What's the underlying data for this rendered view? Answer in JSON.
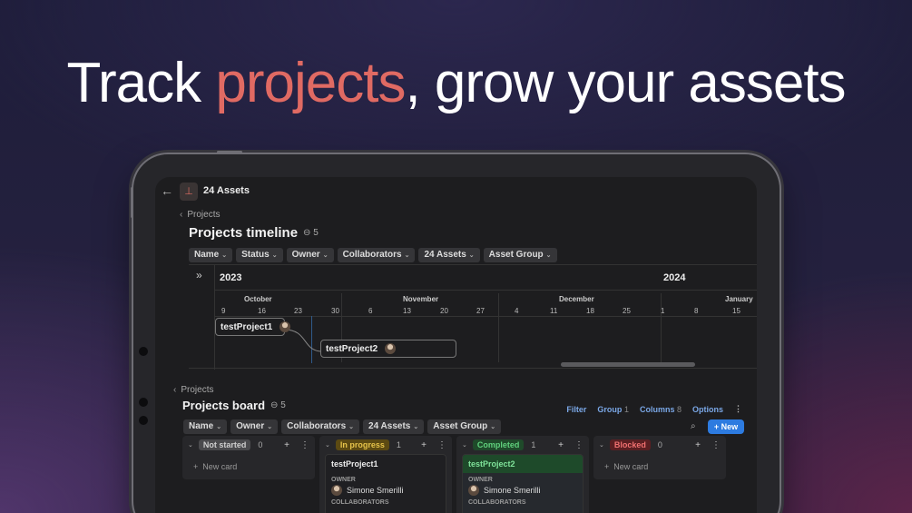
{
  "headline": {
    "before": "Track ",
    "highlight": "projects",
    "after": ", grow your assets"
  },
  "colors": {
    "highlight": "#e06a63",
    "accent_blue": "#2d7be0",
    "link_blue": "#7aa7e6"
  },
  "app": {
    "back_icon": "arrow-left-icon",
    "page_icon": "assets-icon",
    "title": "24 Assets"
  },
  "timeline_section": {
    "breadcrumb": "Projects",
    "title": "Projects timeline",
    "link_count": "5",
    "filters": [
      "Name",
      "Status",
      "Owner",
      "Collaborators",
      "24 Assets",
      "Asset Group"
    ],
    "years": [
      "2023",
      "2024"
    ],
    "months": [
      "October",
      "November",
      "December",
      "January"
    ],
    "days": [
      "9",
      "16",
      "23",
      "30",
      "6",
      "13",
      "20",
      "27",
      "4",
      "11",
      "18",
      "25",
      "1",
      "8",
      "15"
    ],
    "tasks": [
      {
        "name": "testProject1"
      },
      {
        "name": "testProject2"
      }
    ]
  },
  "board_section": {
    "breadcrumb": "Projects",
    "title": "Projects board",
    "link_count": "5",
    "actions": {
      "filter": "Filter",
      "group": "Group",
      "group_count": "1",
      "columns": "Columns",
      "columns_count": "8",
      "options": "Options"
    },
    "filters": [
      "Name",
      "Owner",
      "Collaborators",
      "24 Assets",
      "Asset Group"
    ],
    "new_button": "+ New",
    "columns": [
      {
        "status": "Not started",
        "count": "0",
        "badge_bg": "#4a4a4d",
        "badge_fg": "#cfcfcf",
        "new_card": "New card"
      },
      {
        "status": "In progress",
        "count": "1",
        "badge_bg": "#5c4a12",
        "badge_fg": "#e6c34a",
        "card": {
          "title": "testProject1",
          "owner_label": "OWNER",
          "owner": "Simone Smerilli",
          "collab_label": "COLLABORATORS"
        }
      },
      {
        "status": "Completed",
        "count": "1",
        "badge_bg": "#1f4a2a",
        "badge_fg": "#5fd07c",
        "card": {
          "title": "testProject2",
          "owner_label": "OWNER",
          "owner": "Simone Smerilli",
          "collab_label": "COLLABORATORS",
          "title_bg": "#1e4a2a",
          "title_fg": "#7fe39a"
        }
      },
      {
        "status": "Blocked",
        "count": "0",
        "badge_bg": "#5a1f22",
        "badge_fg": "#f07070",
        "new_card": "New card"
      }
    ]
  }
}
